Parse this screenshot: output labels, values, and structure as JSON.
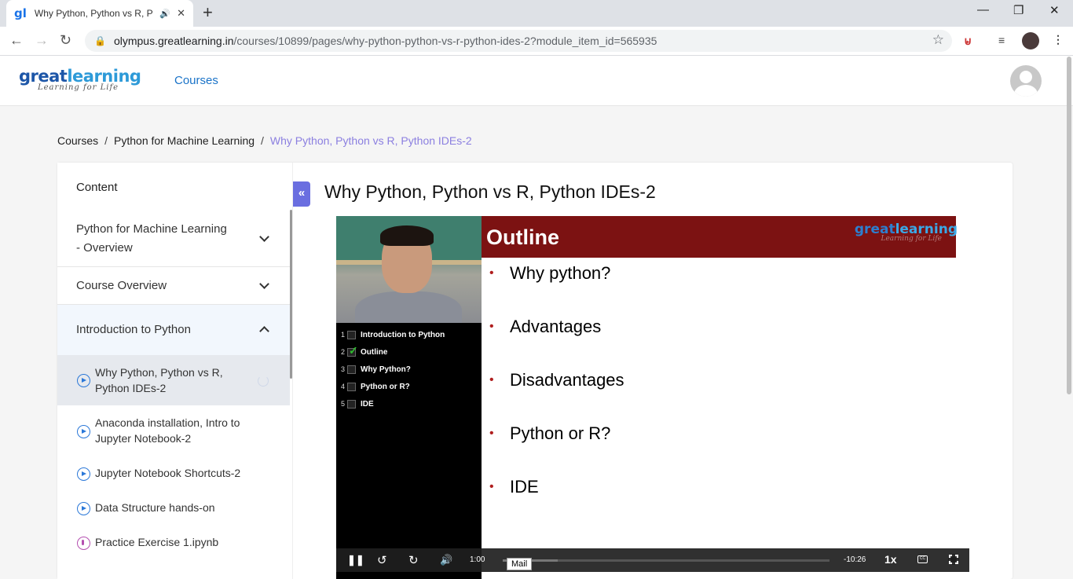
{
  "browser": {
    "tab_title": "Why Python, Python vs R, Py",
    "favicon": "gl",
    "url_host": "olympus.greatlearning.in",
    "url_path": "/courses/10899/pages/why-python-python-vs-r-python-ides-2?module_item_id=565935"
  },
  "header": {
    "brand_great": "great",
    "brand_learning": "learning",
    "tagline": "Learning for Life",
    "courses_link": "Courses"
  },
  "breadcrumb": {
    "items": [
      "Courses",
      "Python for Machine Learning"
    ],
    "current": "Why Python, Python vs R, Python IDEs-2",
    "separator": "/"
  },
  "sidebar": {
    "title": "Content",
    "modules": [
      {
        "label_line1": "Python for Machine Learning",
        "label_line2": "- Overview",
        "expanded": false
      },
      {
        "label": "Course Overview",
        "expanded": false
      },
      {
        "label": "Introduction to Python",
        "expanded": true
      }
    ],
    "lessons": [
      {
        "line1": "Why Python, Python vs R,",
        "line2": "Python IDEs-2",
        "type": "video",
        "active": true
      },
      {
        "line1": "Anaconda installation, Intro to",
        "line2": "Jupyter Notebook-2",
        "type": "video"
      },
      {
        "line1": "Jupyter Notebook Shortcuts-2",
        "type": "video"
      },
      {
        "line1": "Data Structure hands-on",
        "type": "video"
      },
      {
        "line1": "Practice Exercise 1.ipynb",
        "type": "notebook"
      }
    ]
  },
  "main": {
    "title": "Why Python, Python vs R, Python IDEs-2",
    "collapse_icon": "«"
  },
  "video": {
    "slide_title": "Outline",
    "slide_brand_great": "great",
    "slide_brand_learning": "learning",
    "slide_tagline": "Learning for Life",
    "toc": [
      {
        "n": "1",
        "label": "Introduction to Python",
        "checked": false
      },
      {
        "n": "2",
        "label": "Outline",
        "checked": true
      },
      {
        "n": "3",
        "label": "Why Python?",
        "checked": false
      },
      {
        "n": "4",
        "label": "Python or R?",
        "checked": false
      },
      {
        "n": "5",
        "label": "IDE",
        "checked": false
      }
    ],
    "bullets": [
      "Why python?",
      "Advantages",
      "Disadvantages",
      "Python or R?",
      "IDE"
    ],
    "elapsed": "1:00",
    "remaining": "-10:26",
    "speed": "1x",
    "tooltip": "Mail",
    "cc": "CC",
    "progress_fraction": 0.09
  }
}
